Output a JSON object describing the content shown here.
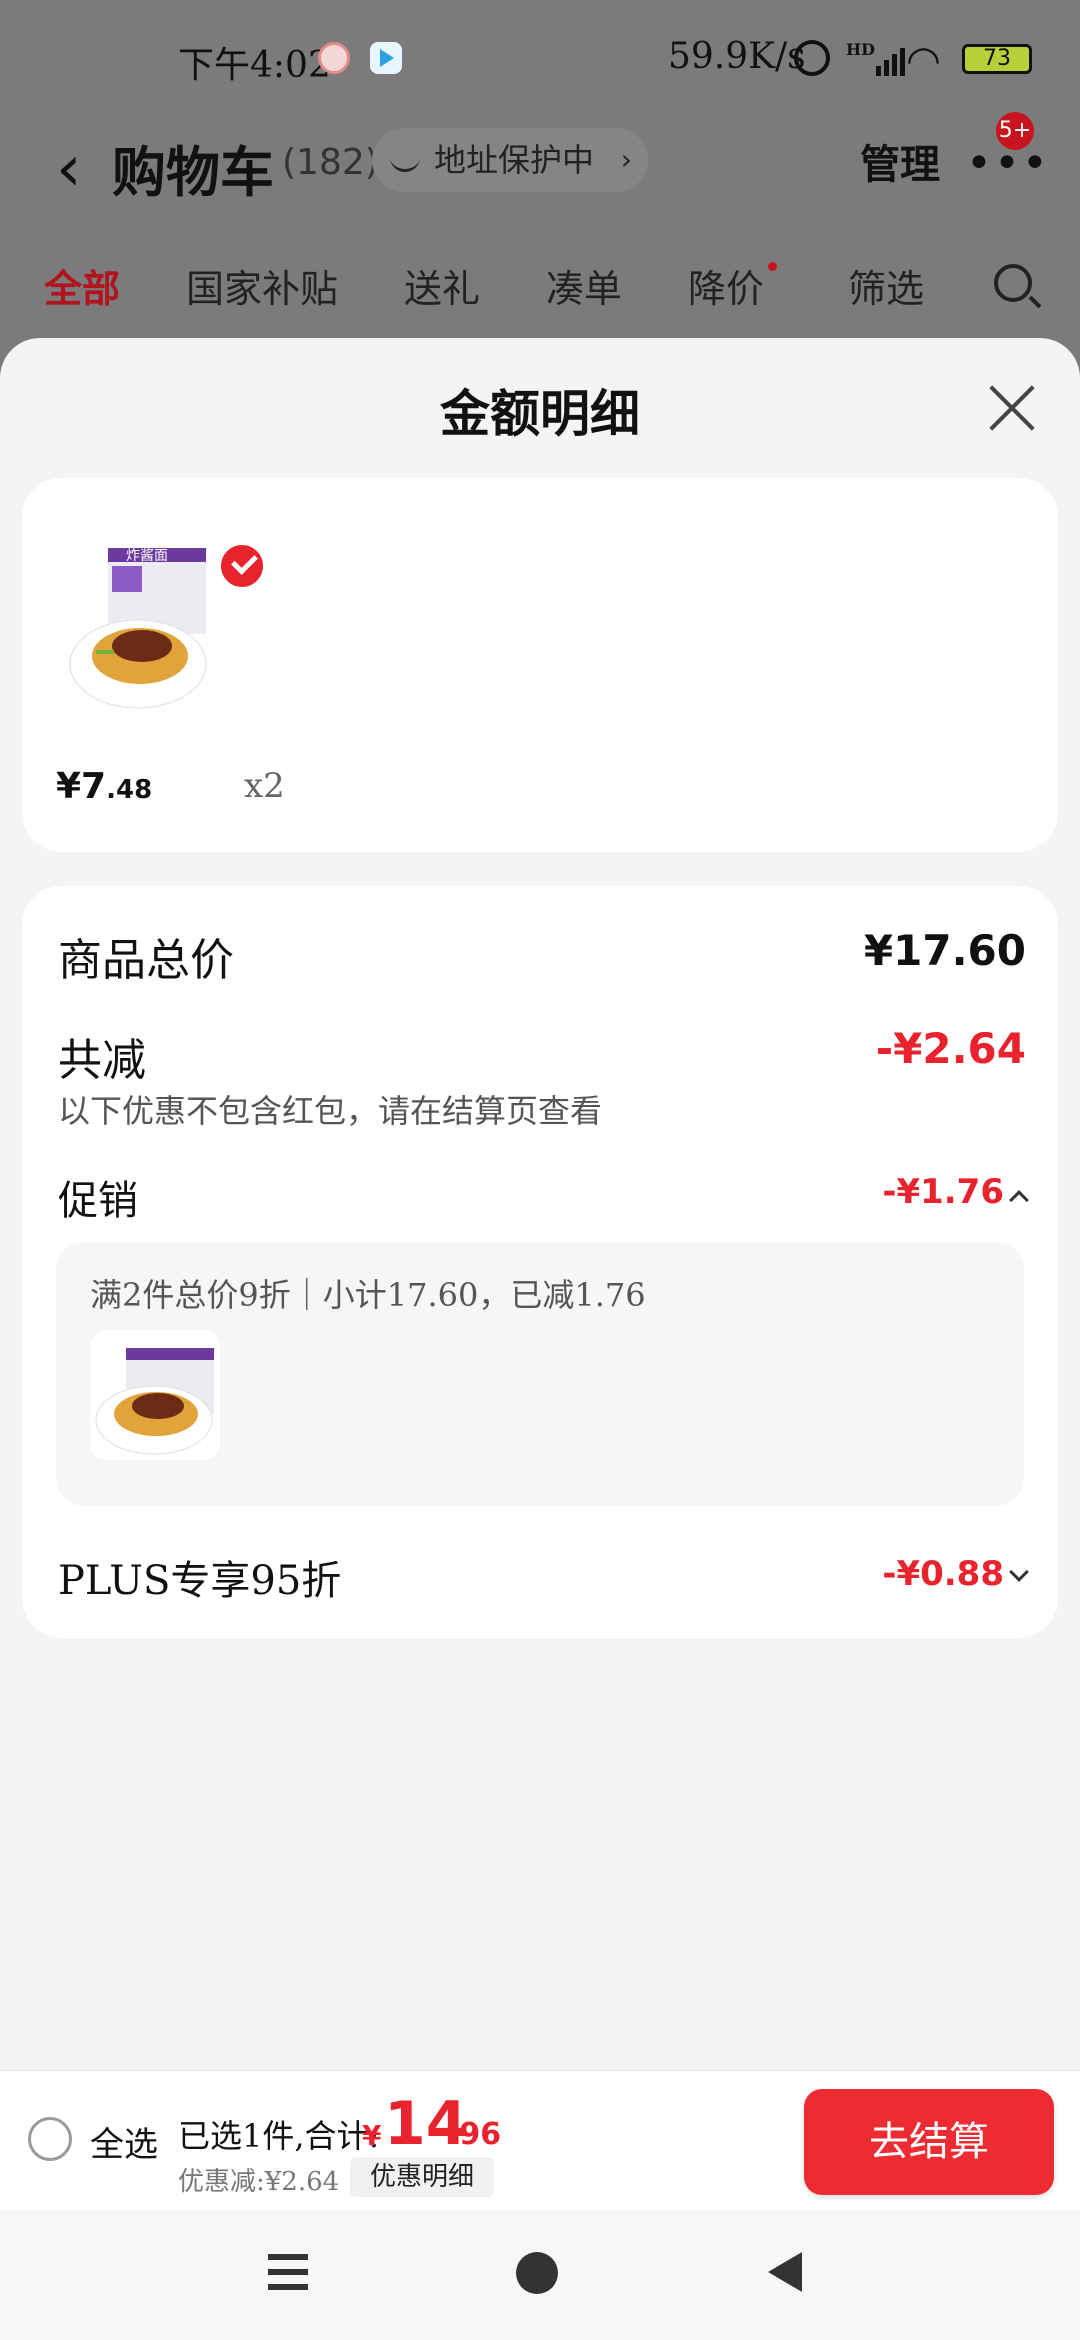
{
  "status_bar": {
    "time": "下午4:02",
    "net_speed": "59.9K/s",
    "battery": "73"
  },
  "header": {
    "title": "购物车",
    "count": "(182)",
    "address": "地址保护中",
    "manage": "管理",
    "badge": "5+"
  },
  "tabs": [
    "全部",
    "国家补贴",
    "送礼",
    "凑单",
    "降价",
    "筛选"
  ],
  "sheet": {
    "title": "金额明细",
    "item": {
      "price_int": "¥7",
      "price_dec": ".48",
      "qty": "x2",
      "name": "炸酱面"
    },
    "summary": {
      "total_label": "商品总价",
      "total_value": "¥17.60",
      "discount_label": "共减",
      "discount_value": "-¥2.64",
      "discount_note": "以下优惠不包含红包，请在结算页查看",
      "promo_label": "促销",
      "promo_value": "-¥1.76",
      "promo_detail": "满2件总价9折｜小计17.60，已减1.76",
      "plus_label": "PLUS专享95折",
      "plus_value": "-¥0.88"
    }
  },
  "footer": {
    "select_all": "全选",
    "selected_text": "已选1件,合计:",
    "total_symbol": "¥",
    "total_int": "14",
    "total_dec": ".96",
    "discount_text": "优惠减:¥2.64",
    "detail_button": "优惠明细",
    "checkout": "去结算"
  },
  "colors": {
    "accent": "#e8232d",
    "brand_red": "#b0141e"
  }
}
